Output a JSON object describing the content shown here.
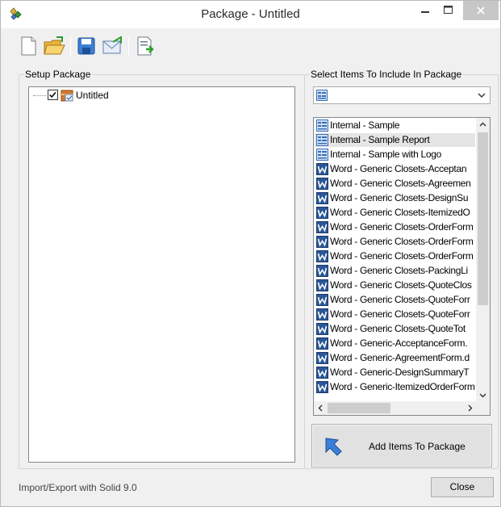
{
  "window": {
    "title": "Package - Untitled"
  },
  "toolbar": {
    "buttons": [
      "new-icon",
      "open-folder-icon",
      "save-icon",
      "email-icon",
      "export-icon"
    ]
  },
  "setup": {
    "label": "Setup Package",
    "tree": [
      {
        "label": "Untitled",
        "checked": true
      }
    ]
  },
  "select": {
    "label": "Select Items To Include In Package",
    "combo_value": "",
    "items": [
      {
        "label": "Internal - Sample",
        "icon": "report-icon"
      },
      {
        "label": "Internal - Sample Report",
        "icon": "report-icon",
        "selected": true
      },
      {
        "label": "Internal - Sample with Logo",
        "icon": "report-icon"
      },
      {
        "label": "Word - Generic Closets-Acceptan",
        "icon": "word-icon"
      },
      {
        "label": "Word - Generic Closets-Agreemen",
        "icon": "word-icon"
      },
      {
        "label": "Word - Generic Closets-DesignSu",
        "icon": "word-icon"
      },
      {
        "label": "Word - Generic Closets-ItemizedO",
        "icon": "word-icon"
      },
      {
        "label": "Word - Generic Closets-OrderForm",
        "icon": "word-icon"
      },
      {
        "label": "Word - Generic Closets-OrderForm",
        "icon": "word-icon"
      },
      {
        "label": "Word - Generic Closets-OrderForm",
        "icon": "word-icon"
      },
      {
        "label": "Word - Generic Closets-PackingLi",
        "icon": "word-icon"
      },
      {
        "label": "Word - Generic Closets-QuoteClos",
        "icon": "word-icon"
      },
      {
        "label": "Word - Generic Closets-QuoteForr",
        "icon": "word-icon"
      },
      {
        "label": "Word - Generic Closets-QuoteForr",
        "icon": "word-icon"
      },
      {
        "label": "Word - Generic Closets-QuoteTot",
        "icon": "word-icon"
      },
      {
        "label": "Word - Generic-AcceptanceForm.",
        "icon": "word-icon"
      },
      {
        "label": "Word - Generic-AgreementForm.d",
        "icon": "word-icon"
      },
      {
        "label": "Word - Generic-DesignSummaryT",
        "icon": "word-icon"
      },
      {
        "label": "Word - Generic-ItemizedOrderForm",
        "icon": "word-icon"
      }
    ],
    "add_button": "Add Items To Package"
  },
  "status": "Import/Export with Solid 9.0",
  "close_button": "Close",
  "colors": {
    "word_blue": "#2b5797",
    "accent": "#3c7fd6"
  }
}
